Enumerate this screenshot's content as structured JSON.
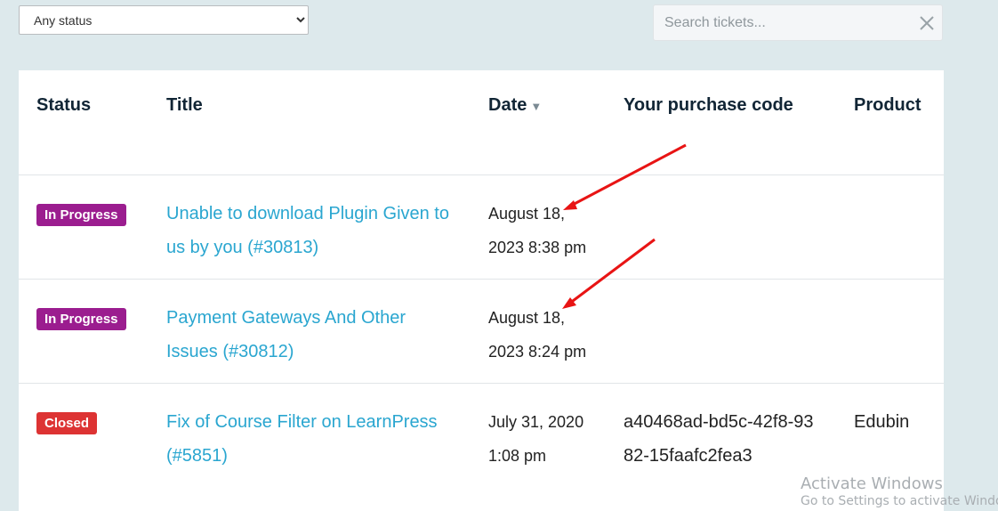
{
  "filters": {
    "status_select": {
      "selected": "Any status"
    },
    "search": {
      "placeholder": "Search tickets...",
      "value": ""
    }
  },
  "table": {
    "headers": {
      "status": "Status",
      "title": "Title",
      "date": "Date",
      "purchase_code": "Your purchase code",
      "product": "Product"
    },
    "rows": [
      {
        "status": "In Progress",
        "status_color": "#9b1d8f",
        "title": "Unable to download Plugin Given to us by you (#30813)",
        "date": "August 18, 2023 8:38 pm",
        "purchase_code": "",
        "product": ""
      },
      {
        "status": "In Progress",
        "status_color": "#9b1d8f",
        "title": "Payment Gateways And Other Issues (#30812)",
        "date": "August 18, 2023 8:24 pm",
        "purchase_code": "",
        "product": ""
      },
      {
        "status": "Closed",
        "status_color": "#dd3333",
        "title": "Fix of Course Filter on LearnPress (#5851)",
        "date": "July 31, 2020 1:08 pm",
        "purchase_code": "a40468ad-bd5c-42f8-9382-15faafc2fea3",
        "product": "Edubin"
      }
    ]
  },
  "watermark": {
    "line1": "Activate Windows",
    "line2": "Go to Settings to activate Windows."
  },
  "colors": {
    "page_bg": "#dde9ec",
    "link": "#2aa6d0",
    "annotation_arrow": "#e81414"
  },
  "icons": {
    "sort": "sort-down-icon",
    "clear": "close-icon",
    "dropdown": "chevron-down-icon"
  }
}
